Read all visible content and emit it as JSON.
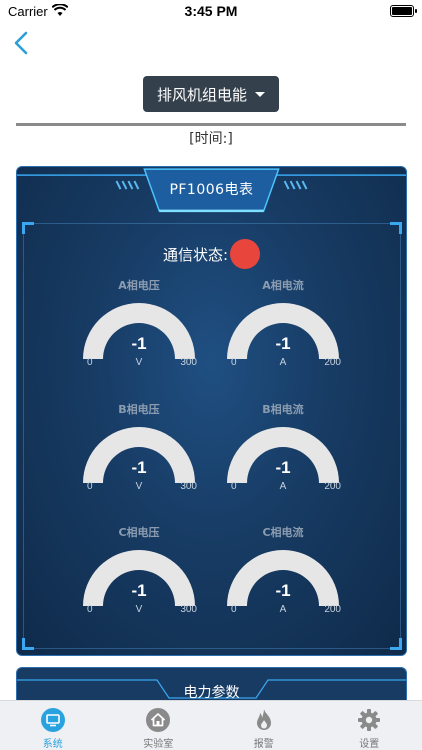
{
  "status_bar": {
    "carrier": "Carrier",
    "time": "3:45 PM"
  },
  "selector": {
    "label": "排风机组电能"
  },
  "time_label": "[时间:]",
  "meter_panel": {
    "title": "PF1006电表",
    "comm_label": "通信状态:",
    "comm_status_color": "#e8453c",
    "gauges": [
      {
        "title": "A相电压",
        "value": "-1",
        "min": "0",
        "unit": "V",
        "max": "300"
      },
      {
        "title": "A相电流",
        "value": "-1",
        "min": "0",
        "unit": "A",
        "max": "200"
      },
      {
        "title": "B相电压",
        "value": "-1",
        "min": "0",
        "unit": "V",
        "max": "300"
      },
      {
        "title": "B相电流",
        "value": "-1",
        "min": "0",
        "unit": "A",
        "max": "200"
      },
      {
        "title": "C相电压",
        "value": "-1",
        "min": "0",
        "unit": "V",
        "max": "300"
      },
      {
        "title": "C相电流",
        "value": "-1",
        "min": "0",
        "unit": "A",
        "max": "200"
      }
    ]
  },
  "power_panel": {
    "title": "电力参数"
  },
  "tabbar": {
    "items": [
      {
        "label": "系统",
        "icon": "monitor-icon",
        "active": true
      },
      {
        "label": "实验室",
        "icon": "home-icon",
        "active": false
      },
      {
        "label": "报警",
        "icon": "flame-icon",
        "active": false
      },
      {
        "label": "设置",
        "icon": "gear-icon",
        "active": false
      }
    ]
  },
  "colors": {
    "accent": "#29a3df",
    "panel_bg": "#173b63",
    "gauge_arc": "#e6e6e6",
    "alarm_red": "#e8453c"
  }
}
